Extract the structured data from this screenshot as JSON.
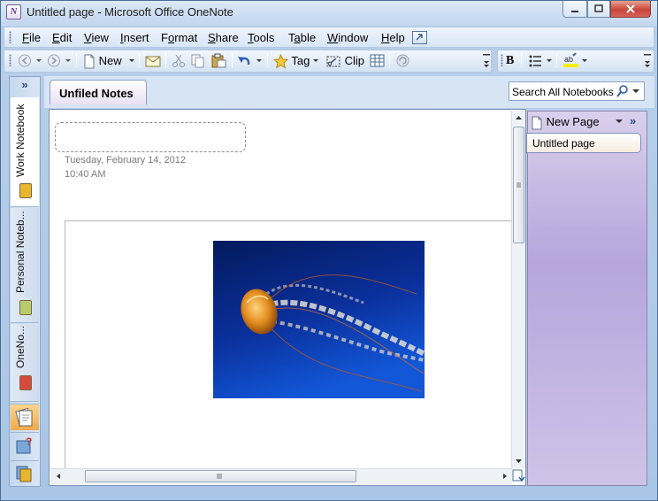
{
  "window": {
    "title": "Untitled page - Microsoft Office OneNote",
    "app_icon_glyph": "N"
  },
  "menubar": {
    "items": [
      {
        "label": "File",
        "u": "F"
      },
      {
        "label": "Edit",
        "u": "E"
      },
      {
        "label": "View",
        "u": "V"
      },
      {
        "label": "Insert",
        "u": "I"
      },
      {
        "label": "Format",
        "u": "o"
      },
      {
        "label": "Share",
        "u": "S"
      },
      {
        "label": "Tools",
        "u": "T"
      },
      {
        "label": "Table",
        "u": "a"
      },
      {
        "label": "Window",
        "u": "W"
      },
      {
        "label": "Help",
        "u": "H"
      }
    ]
  },
  "toolbar": {
    "new_label": "New",
    "tag_label": "Tag",
    "clip_label": "Clip",
    "bold_label": "B"
  },
  "notebooks": [
    {
      "label": "Work Notebook",
      "color": "#e8b52f"
    },
    {
      "label": "Personal Noteb...",
      "color": "#b7cc6a"
    },
    {
      "label": "OneNo...",
      "color": "#d84b3c"
    }
  ],
  "sidebar_expand": "»",
  "section": {
    "tab_label": "Unfiled Notes"
  },
  "search": {
    "placeholder": "Search All Notebooks"
  },
  "page": {
    "date": "Tuesday, February 14, 2012",
    "time": "10:40 AM"
  },
  "pages_panel": {
    "new_page_label": "New Page",
    "expand": "»",
    "items": [
      "Untitled page"
    ]
  },
  "colors": {
    "accent": "#c2d6ee",
    "page_panel": "#b7a5dc",
    "close": "#c7463a"
  }
}
